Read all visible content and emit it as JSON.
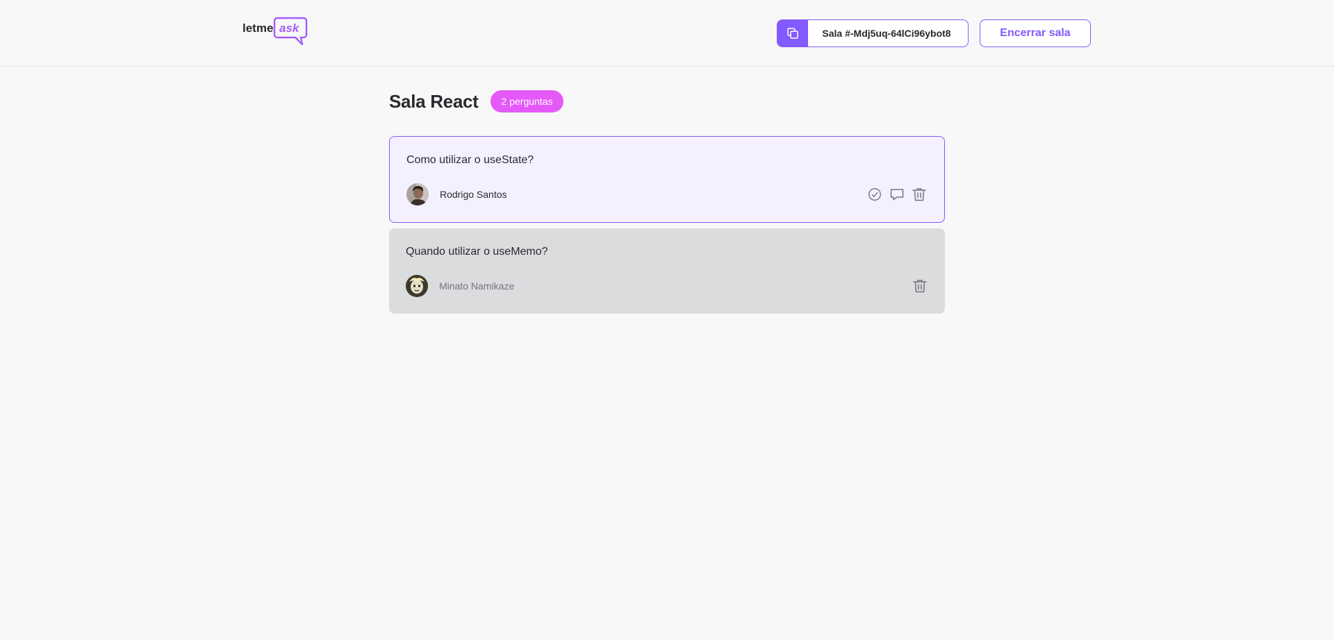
{
  "header": {
    "logo_text_plain": "letme",
    "logo_text_accent": "ask",
    "room_code_label": "Sala #-Mdj5uq-64lCi96ybot8",
    "end_room_label": "Encerrar sala"
  },
  "room": {
    "title": "Sala React",
    "question_count_label": "2 perguntas"
  },
  "questions": [
    {
      "content": "Como utilizar o useState?",
      "author": "Rodrigo Santos",
      "state": "highlighted",
      "actions": [
        "check-circle-icon",
        "answer-icon",
        "delete-icon"
      ]
    },
    {
      "content": "Quando utilizar o useMemo?",
      "author": "Minato Namikaze",
      "state": "answered",
      "actions": [
        "delete-icon"
      ]
    }
  ],
  "colors": {
    "brand_purple": "#835afd",
    "badge_pink": "#e559f9",
    "highlight_bg": "#f4f0ff",
    "answered_bg": "#dbdcdd",
    "page_bg": "#f8f8f8"
  }
}
